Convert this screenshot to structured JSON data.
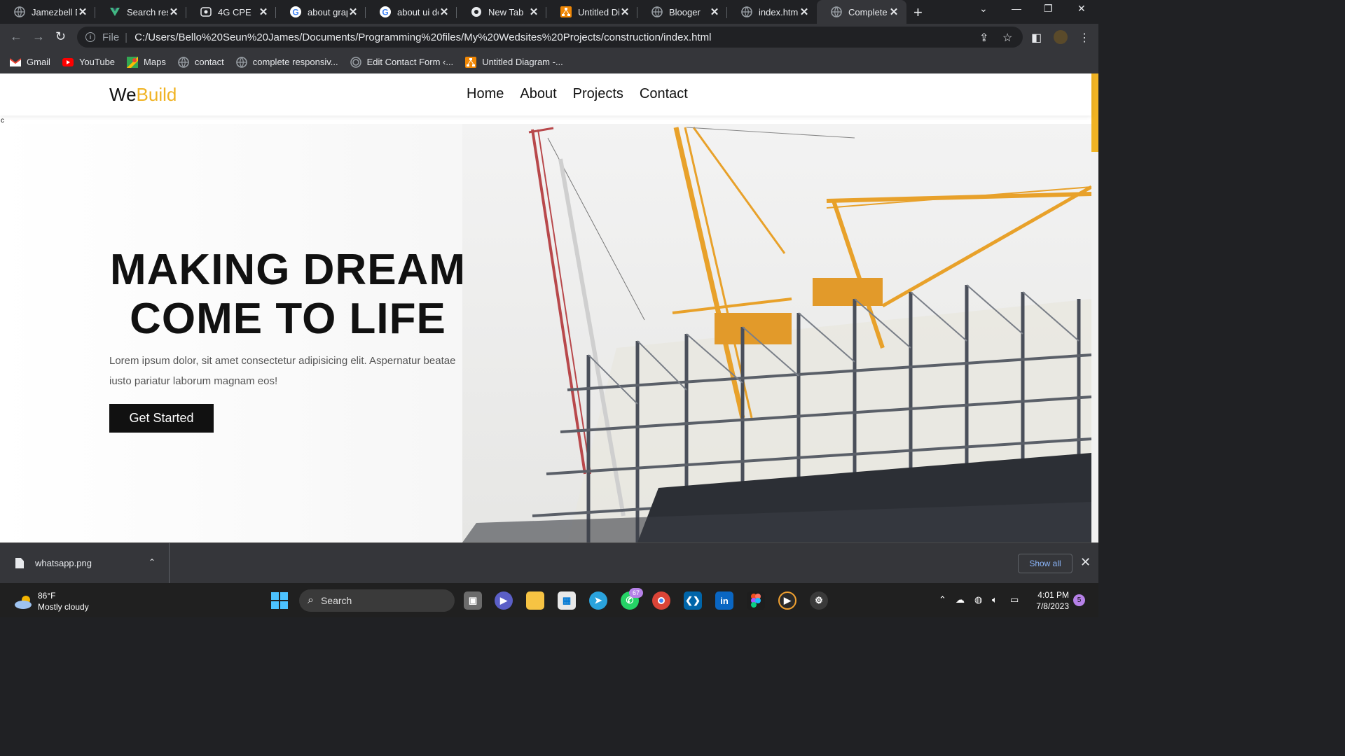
{
  "browser": {
    "tabs": [
      {
        "title": "Jamezbell D",
        "icon": "globe-icon"
      },
      {
        "title": "Search resu",
        "icon": "vue-icon"
      },
      {
        "title": "4G CPE",
        "icon": "router-icon"
      },
      {
        "title": "about grapl",
        "icon": "google-icon"
      },
      {
        "title": "about ui de",
        "icon": "google-icon"
      },
      {
        "title": "New Tab",
        "icon": "chrome-icon"
      },
      {
        "title": "Untitled Dia",
        "icon": "drawio-icon"
      },
      {
        "title": "Blooger",
        "icon": "globe-icon"
      },
      {
        "title": "index.html",
        "icon": "globe-icon"
      },
      {
        "title": "Complete R",
        "icon": "globe-icon",
        "active": true
      }
    ],
    "new_tab": "+",
    "address": {
      "scheme_label": "File",
      "url": "C:/Users/Bello%20Seun%20James/Documents/Programming%20files/My%20Wedsites%20Projects/construction/index.html"
    },
    "bookmarks": [
      {
        "label": "Gmail",
        "icon": "gmail-icon"
      },
      {
        "label": "YouTube",
        "icon": "youtube-icon"
      },
      {
        "label": "Maps",
        "icon": "maps-icon"
      },
      {
        "label": "contact",
        "icon": "globe-icon"
      },
      {
        "label": "complete responsiv...",
        "icon": "globe-icon"
      },
      {
        "label": "Edit Contact Form ‹...",
        "icon": "spiral-icon"
      },
      {
        "label": "Untitled Diagram -...",
        "icon": "drawio-icon"
      }
    ]
  },
  "site": {
    "logo": {
      "part1": "We",
      "part2": "Build"
    },
    "nav": [
      "Home",
      "About",
      "Projects",
      "Contact"
    ],
    "stray_char": "c",
    "hero": {
      "title_line1": "MAKING DREAM",
      "title_line2": "COME TO LIFE",
      "text": "Lorem ipsum dolor, sit amet consectetur adipisicing elit. Aspernatur beatae iusto pariatur laborum magnam eos!",
      "cta": "Get Started"
    },
    "colors": {
      "accent": "#f0b323",
      "dark": "#111111"
    }
  },
  "download_bar": {
    "file": "whatsapp.png",
    "show_all": "Show all"
  },
  "taskbar": {
    "weather": {
      "temp": "86°F",
      "condition": "Mostly cloudy"
    },
    "search": "Search",
    "whatsapp_badge": "67",
    "time": "4:01 PM",
    "date": "7/8/2023",
    "notifications": "5"
  }
}
